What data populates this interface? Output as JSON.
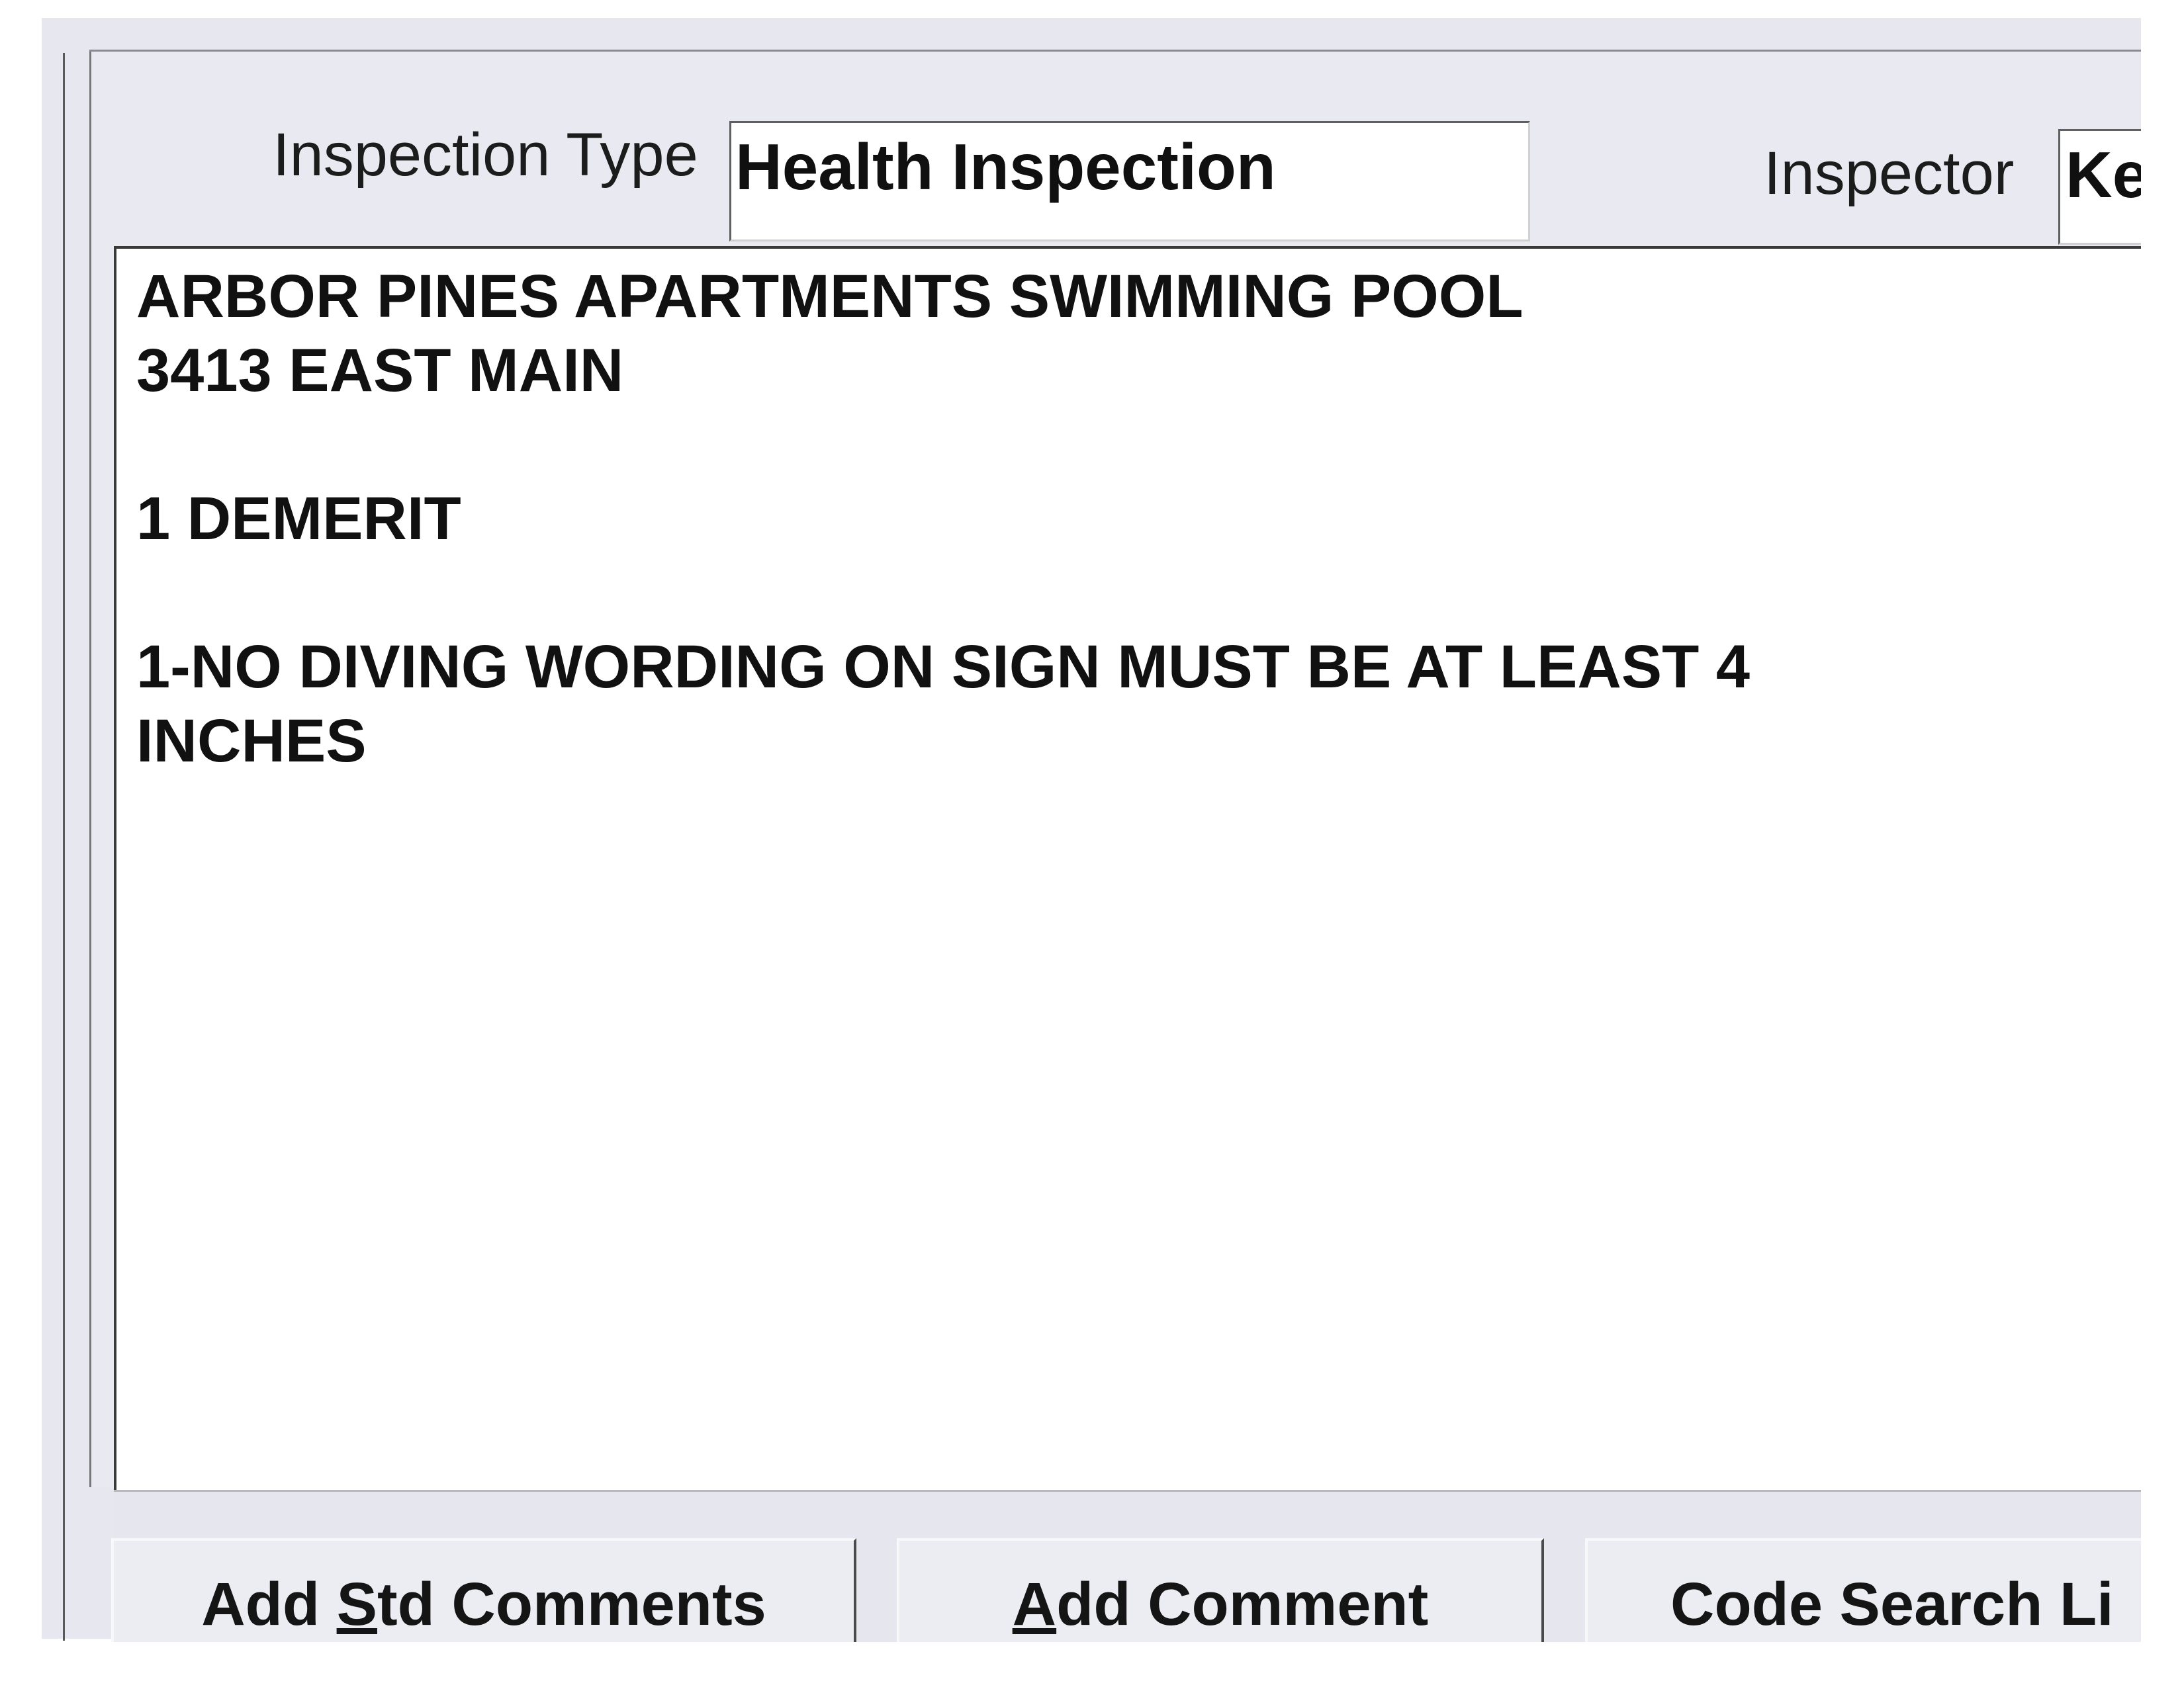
{
  "header": {
    "inspection_type_label": "Inspection Type",
    "inspection_type_value": "Health Inspection",
    "inspector_label": "Inspector",
    "inspector_value": "Ke"
  },
  "comments": {
    "lines": [
      "ARBOR PINES APARTMENTS SWIMMING POOL",
      "3413 EAST MAIN",
      "",
      "1 DEMERIT",
      "",
      "1-NO DIVING WORDING ON SIGN MUST BE AT LEAST 4",
      "INCHES"
    ]
  },
  "buttons": {
    "add_std_comments": {
      "pre": "Add ",
      "key": "S",
      "post": "td Comments"
    },
    "add_comment": {
      "pre": "",
      "key": "A",
      "post": "dd Comment"
    },
    "code_search": {
      "pre": "Code Search Li",
      "key": "",
      "post": ""
    }
  }
}
